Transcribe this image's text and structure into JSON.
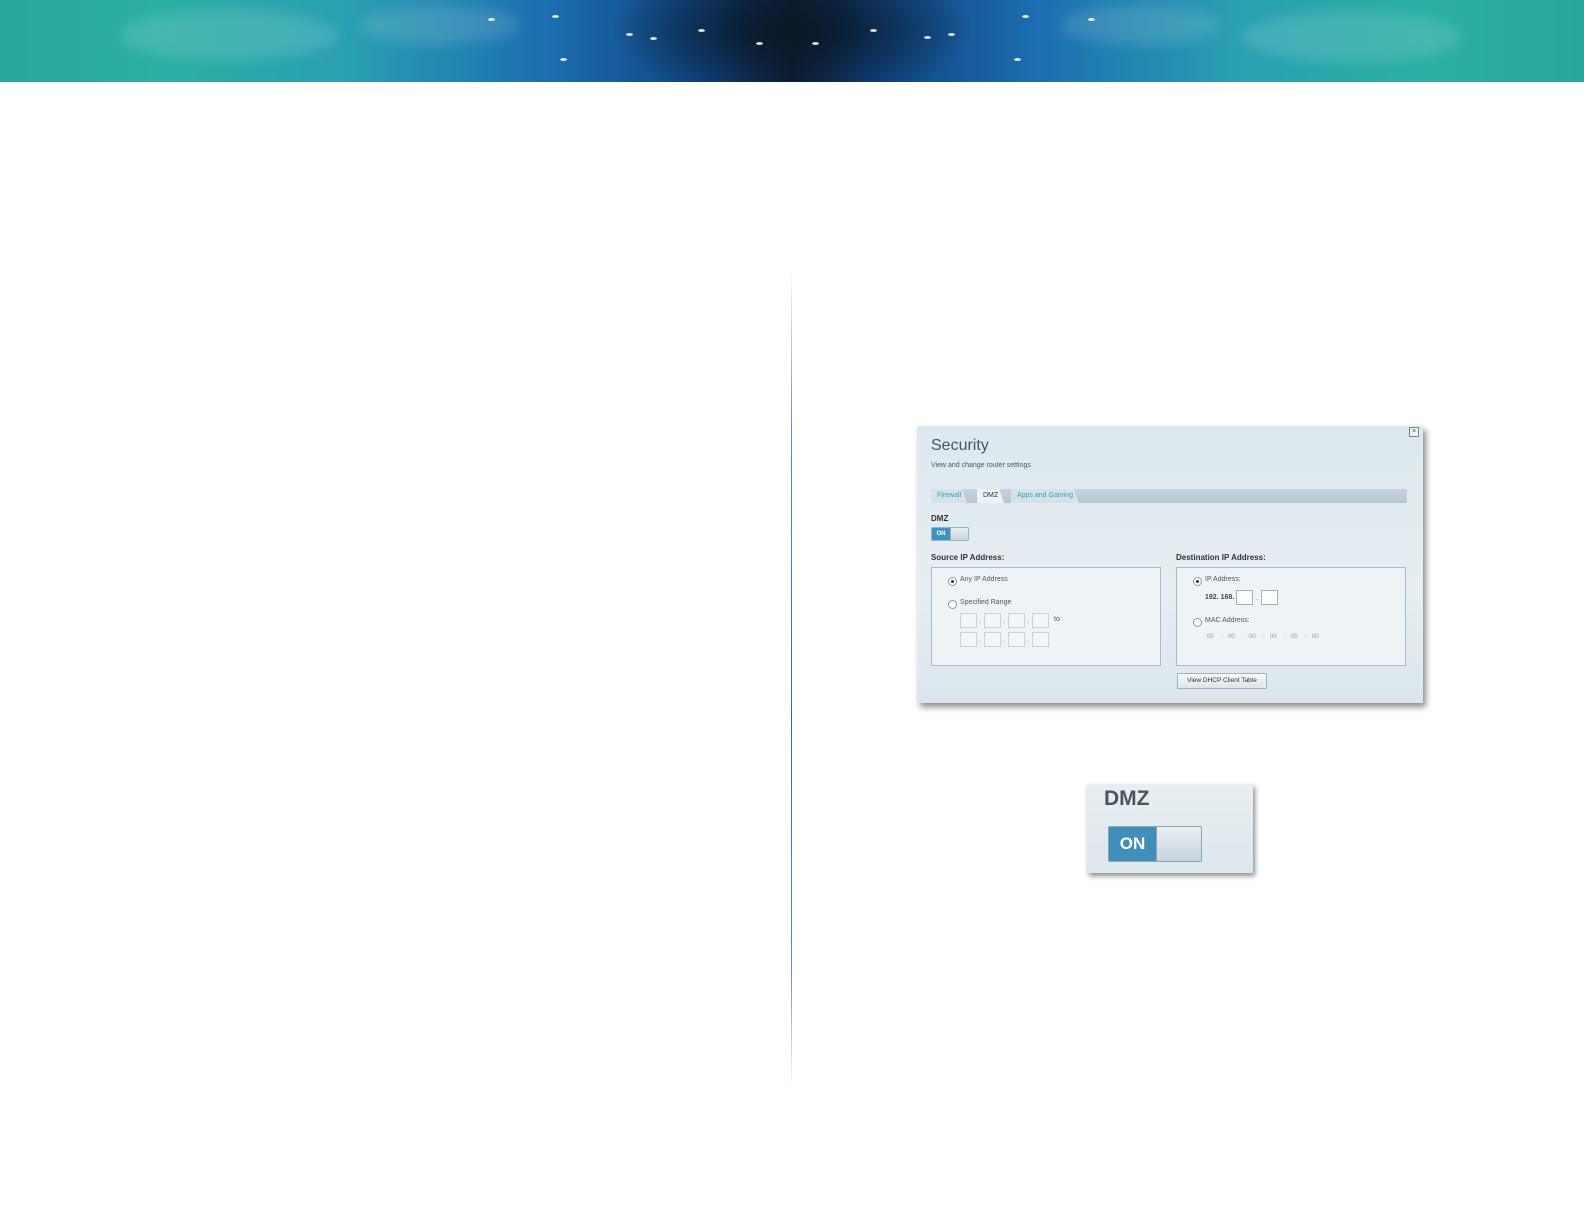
{
  "security_panel": {
    "title": "Security",
    "subtitle": "View and change router settings",
    "close_glyph": "×",
    "tabs": [
      {
        "label": "Firewall",
        "active": false
      },
      {
        "label": "DMZ",
        "active": true
      },
      {
        "label": "Apps and Gaming",
        "active": false
      }
    ],
    "dmz": {
      "label": "DMZ",
      "toggle_state": "ON"
    },
    "source": {
      "heading": "Source IP Address:",
      "any_ip_label": "Any IP Address",
      "any_ip_selected": true,
      "specified_range_label": "Specified Range",
      "specified_range_selected": false,
      "to_label": "to",
      "separator": "."
    },
    "destination": {
      "heading": "Destination IP Address:",
      "ip_address_label": "IP Address:",
      "ip_address_selected": true,
      "ip_prefix": "192. 168.",
      "ip_separator": ".",
      "mac_address_label": "MAC Address:",
      "mac_address_selected": false,
      "mac_octets": [
        "00",
        "00",
        "00",
        "00",
        "00",
        "00"
      ],
      "mac_separator": ":"
    },
    "dhcp_button_label": "View DHCP Client Table"
  },
  "zoom_inset": {
    "label": "DMZ",
    "toggle_state": "ON"
  }
}
